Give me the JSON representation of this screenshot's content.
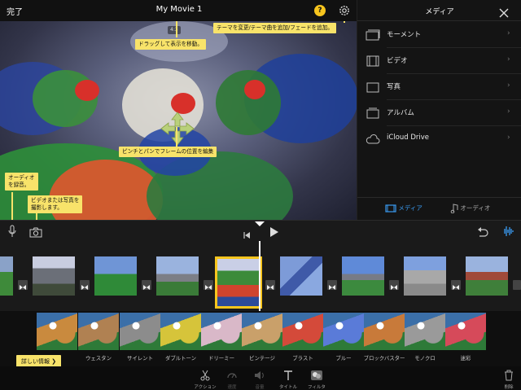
{
  "topbar": {
    "done_label": "完了",
    "title": "My Movie 1",
    "help_label": "?"
  },
  "preview": {
    "resolution_badge": "4:3",
    "tips": {
      "drag_move": "ドラッグして表示を移動。",
      "theme": "テーマを変更/テーマ曲を追加/フェードを追加。",
      "pinch_pan": "ピンチとパンでフレームの位置を編集",
      "audio_record": [
        "オーディオ",
        "を録音。"
      ],
      "video_photo": [
        "ビデオまたは写真を",
        "撮影します。"
      ]
    }
  },
  "media": {
    "title": "メディア",
    "items": [
      {
        "label": "モーメント",
        "icon": "moments-icon"
      },
      {
        "label": "ビデオ",
        "icon": "film-icon"
      },
      {
        "label": "写真",
        "icon": "photo-icon"
      },
      {
        "label": "アルバム",
        "icon": "album-icon"
      },
      {
        "label": "iCloud Drive",
        "icon": "cloud-icon"
      }
    ],
    "tabs": [
      {
        "label": "メディア",
        "icon": "media-tab-icon",
        "active": true
      },
      {
        "label": "オーディオ",
        "icon": "music-note-icon",
        "active": false
      }
    ],
    "chevron": "›"
  },
  "filters": {
    "items": [
      {
        "name": "",
        "tint": "#c98a3e"
      },
      {
        "name": "ウェスタン",
        "tint": "#b08152"
      },
      {
        "name": "サイレント",
        "tint": "#8c8c8c"
      },
      {
        "name": "ダブルトーン",
        "tint": "#d6c43a"
      },
      {
        "name": "ドリーミー",
        "tint": "#d9b8c8"
      },
      {
        "name": "ビンテージ",
        "tint": "#c9a06a"
      },
      {
        "name": "ブラスト",
        "tint": "#d44a3a"
      },
      {
        "name": "ブルー",
        "tint": "#5a7bd8"
      },
      {
        "name": "ブロックバスター",
        "tint": "#c87a3a"
      },
      {
        "name": "モノクロ",
        "tint": "#9a9a9a"
      },
      {
        "name": "迷彩",
        "tint": "#d64a5a"
      }
    ],
    "more_label": "詳しい情報 ❯"
  },
  "toolbar": {
    "tools": [
      {
        "label": "アクション",
        "icon": "scissors-icon"
      },
      {
        "label": "速度",
        "icon": "speed-icon"
      },
      {
        "label": "音量",
        "icon": "volume-icon"
      },
      {
        "label": "タイトル",
        "icon": "title-icon"
      },
      {
        "label": "フィルタ",
        "icon": "filter-icon"
      }
    ],
    "delete_label": "削除"
  },
  "colors": {
    "accent": "#f7c51e",
    "tip": "#f8e36a",
    "media_tab_active": "#3a9af0"
  }
}
